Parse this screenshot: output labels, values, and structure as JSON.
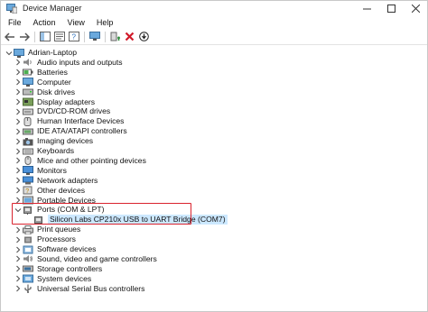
{
  "window": {
    "title": "Device Manager"
  },
  "menu": [
    "File",
    "Action",
    "View",
    "Help"
  ],
  "tree": {
    "root": "Adrian-Laptop",
    "categories": [
      {
        "label": "Audio inputs and outputs",
        "icon": "speaker-icon"
      },
      {
        "label": "Batteries",
        "icon": "battery-icon"
      },
      {
        "label": "Computer",
        "icon": "computer-icon"
      },
      {
        "label": "Disk drives",
        "icon": "disk-drive-icon"
      },
      {
        "label": "Display adapters",
        "icon": "display-adapter-icon"
      },
      {
        "label": "DVD/CD-ROM drives",
        "icon": "dvd-drive-icon"
      },
      {
        "label": "Human Interface Devices",
        "icon": "hid-icon"
      },
      {
        "label": "IDE ATA/ATAPI controllers",
        "icon": "ide-controller-icon"
      },
      {
        "label": "Imaging devices",
        "icon": "camera-icon"
      },
      {
        "label": "Keyboards",
        "icon": "keyboard-icon"
      },
      {
        "label": "Mice and other pointing devices",
        "icon": "mouse-icon"
      },
      {
        "label": "Monitors",
        "icon": "monitor-icon"
      },
      {
        "label": "Network adapters",
        "icon": "network-adapter-icon"
      },
      {
        "label": "Other devices",
        "icon": "other-device-icon"
      },
      {
        "label": "Portable Devices",
        "icon": "portable-device-icon"
      },
      {
        "label": "Ports (COM & LPT)",
        "icon": "port-icon",
        "expanded": true,
        "children": [
          {
            "label": "Silicon Labs CP210x USB to UART Bridge (COM7)",
            "icon": "port-icon"
          }
        ]
      },
      {
        "label": "Print queues",
        "icon": "printer-icon"
      },
      {
        "label": "Processors",
        "icon": "processor-icon"
      },
      {
        "label": "Software devices",
        "icon": "software-device-icon"
      },
      {
        "label": "Sound, video and game controllers",
        "icon": "sound-icon"
      },
      {
        "label": "Storage controllers",
        "icon": "storage-controller-icon"
      },
      {
        "label": "System devices",
        "icon": "system-device-icon"
      },
      {
        "label": "Universal Serial Bus controllers",
        "icon": "usb-icon"
      }
    ]
  },
  "colors": {
    "highlight_border": "#d9232e",
    "uninstall_red": "#d11a2a",
    "enable_green": "#2e8b3a"
  }
}
